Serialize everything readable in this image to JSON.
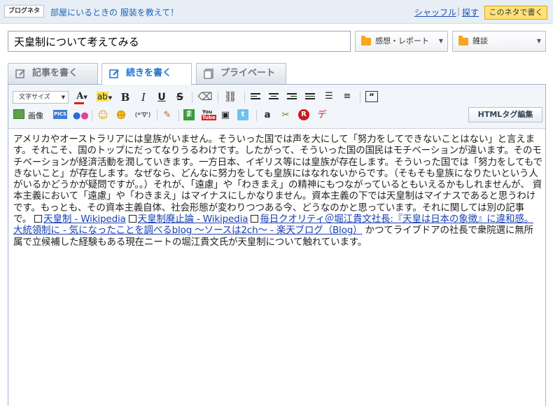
{
  "topbar": {
    "badge": "ブログネタ",
    "topic": "部屋にいるときの 服装を教えて！",
    "shuffle": "シャッフル",
    "separator": "|",
    "search": "探す",
    "use_topic": "このネタで書く"
  },
  "entry": {
    "title": "天皇制について考えてみる",
    "theme": "感想・レポート",
    "genre": "雑談"
  },
  "tabs": [
    {
      "label": "記事を書く",
      "active": false
    },
    {
      "label": "続きを書く",
      "active": true
    },
    {
      "label": "プライベート",
      "active": false
    }
  ],
  "toolbar": {
    "font_size": "文字サイズ",
    "image": "画像",
    "emoticon": "(*'∇')",
    "html_tag_edit": "HTMLタグ編集"
  },
  "body": {
    "p1": "アメリカやオーストラリアには皇族がいません。そういった国では声を大にして「努力をしてできないことはない」と言えます。それこそ、国のトップにだってなりうるわけです。したがって、そういった国の国民はモチベーションが違います。そのモチベーションが経済活動を潤していきます。一方日本、イギリス等には皇族が存在します。そういった国では「努力をしてもできないこと」が存在します。なぜなら、どんなに努力をしても皇族にはなれないからです。（そもそも皇族になりたいという人がいるかどうかが疑問ですが。。）それが、「遠慮」や「わきまえ」の精神にもつながっているともいえるかもしれませんが、 資本主義において「遠慮」や「わきまえ」はマイナスにしかなりません。資本主義の下では天皇制はマイナスであると思うわけです。もっとも、その資本主義自体、社会形態が変わりつつある今、どうなのかと思っています。それに関しては別の記事で。",
    "link1": "天皇制 - Wikipedia",
    "link2": "天皇制廃止論 - Wikipedia",
    "link3": "毎日クオリティ＠堀江貴文社長:『天皇は日本の象徴』に違和感。大統領制に - 気になったことを調べるblog ～ソースは2ch～ - 楽天ブログ（Blog）",
    "p2": " かつてライブドアの社長で衆院選に無所属で立候補した経験もある現在ニートの堀江貴文氏が天皇制について触れています。"
  },
  "colors": {
    "accent_blue": "#1f75d1",
    "link": "#1a3fb3",
    "folder": "#f5a623",
    "button_yellow": "#ffe27a"
  }
}
